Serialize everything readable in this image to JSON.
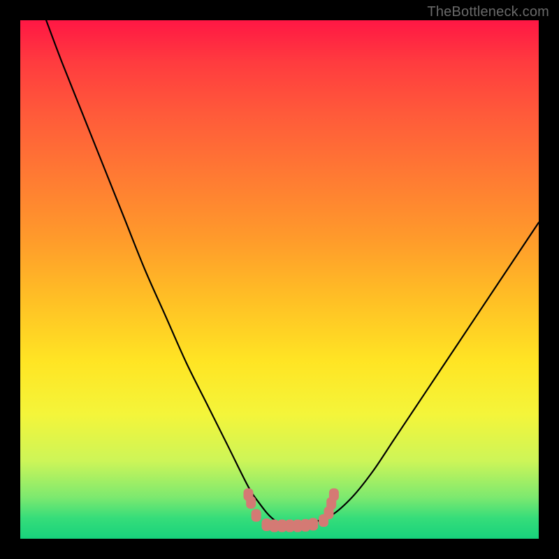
{
  "watermark": "TheBottleneck.com",
  "chart_data": {
    "type": "line",
    "title": "",
    "xlabel": "",
    "ylabel": "",
    "xlim": [
      0,
      100
    ],
    "ylim": [
      0,
      100
    ],
    "series": [
      {
        "name": "bottleneck-curve",
        "x": [
          5,
          8,
          12,
          16,
          20,
          24,
          28,
          32,
          36,
          40,
          44,
          46,
          48,
          50,
          52,
          54,
          56,
          60,
          64,
          68,
          72,
          76,
          80,
          84,
          88,
          92,
          96,
          100
        ],
        "y": [
          100,
          92,
          82,
          72,
          62,
          52,
          43,
          34,
          26,
          18,
          10,
          7,
          4.5,
          3,
          2.5,
          2.5,
          3,
          4.5,
          8,
          13,
          19,
          25,
          31,
          37,
          43,
          49,
          55,
          61
        ]
      }
    ],
    "markers": [
      {
        "name": "left-cluster-1",
        "x": 44.0,
        "y": 8.5
      },
      {
        "name": "left-cluster-2",
        "x": 44.5,
        "y": 7.0
      },
      {
        "name": "left-cluster-3",
        "x": 45.5,
        "y": 4.5
      },
      {
        "name": "bottom-1",
        "x": 47.5,
        "y": 2.7
      },
      {
        "name": "bottom-2",
        "x": 49.0,
        "y": 2.5
      },
      {
        "name": "bottom-3",
        "x": 50.5,
        "y": 2.5
      },
      {
        "name": "bottom-4",
        "x": 52.0,
        "y": 2.5
      },
      {
        "name": "bottom-5",
        "x": 53.5,
        "y": 2.5
      },
      {
        "name": "bottom-6",
        "x": 55.0,
        "y": 2.6
      },
      {
        "name": "bottom-7",
        "x": 56.5,
        "y": 2.8
      },
      {
        "name": "right-cluster-1",
        "x": 58.5,
        "y": 3.5
      },
      {
        "name": "right-cluster-2",
        "x": 59.5,
        "y": 5.0
      },
      {
        "name": "right-cluster-3",
        "x": 60.0,
        "y": 6.8
      },
      {
        "name": "right-cluster-4",
        "x": 60.5,
        "y": 8.5
      }
    ],
    "marker_color": "#d47a74",
    "curve_color": "#000000"
  }
}
